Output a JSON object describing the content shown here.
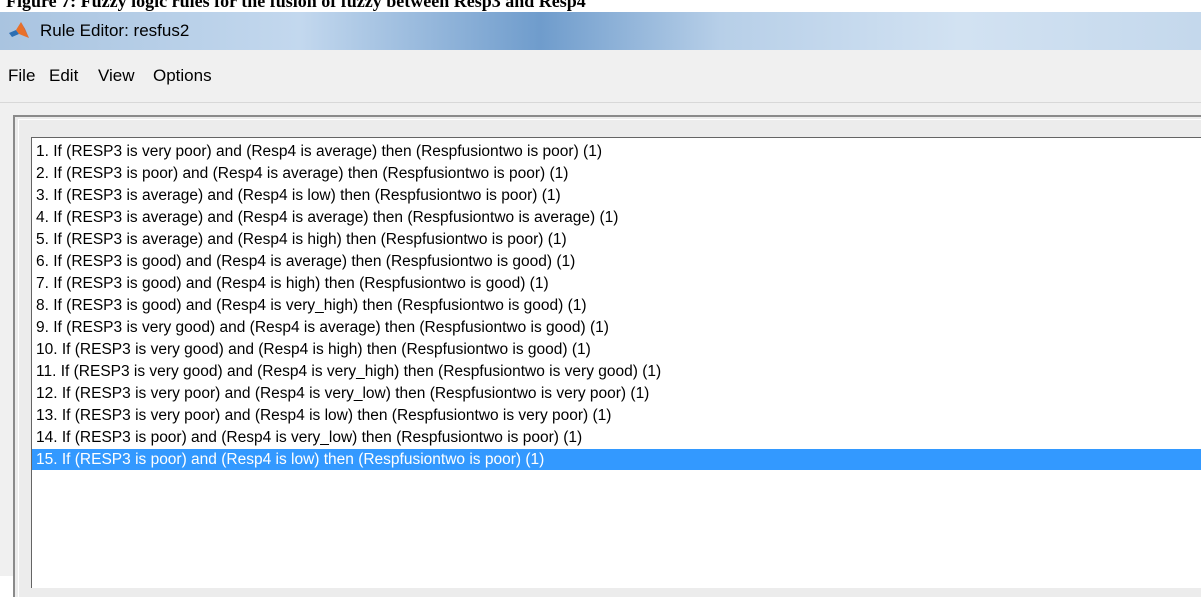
{
  "caption": "Figure 7: Fuzzy logic rules for the fusion of fuzzy between Resp3 and Resp4",
  "window": {
    "title": "Rule Editor: resfus2",
    "icon": "matlab-logo-icon"
  },
  "menu": {
    "items": [
      {
        "label": "File"
      },
      {
        "label": "Edit"
      },
      {
        "label": "View"
      },
      {
        "label": "Options"
      }
    ]
  },
  "rules": {
    "selected_index": 15,
    "items": [
      {
        "text": "1. If (RESP3 is very poor) and (Resp4 is average) then (Respfusiontwo is poor) (1)"
      },
      {
        "text": "2. If (RESP3 is poor) and (Resp4 is average) then (Respfusiontwo is poor) (1)"
      },
      {
        "text": "3. If (RESP3 is average) and (Resp4 is low) then (Respfusiontwo is poor) (1)"
      },
      {
        "text": "4. If (RESP3 is average) and (Resp4 is average) then (Respfusiontwo is average) (1)"
      },
      {
        "text": "5. If (RESP3 is average) and (Resp4 is high) then (Respfusiontwo is poor) (1)"
      },
      {
        "text": "6. If (RESP3 is good) and (Resp4 is average) then (Respfusiontwo is good) (1)"
      },
      {
        "text": "7. If (RESP3 is good) and (Resp4 is high) then (Respfusiontwo is good) (1)"
      },
      {
        "text": "8. If (RESP3 is good) and (Resp4 is very_high) then (Respfusiontwo is good) (1)"
      },
      {
        "text": "9. If (RESP3 is very good) and (Resp4 is average) then (Respfusiontwo is good) (1)"
      },
      {
        "text": "10. If (RESP3 is very good) and (Resp4 is high) then (Respfusiontwo is good) (1)"
      },
      {
        "text": "11. If (RESP3 is very good) and (Resp4 is very_high) then (Respfusiontwo is very good) (1)"
      },
      {
        "text": "12. If (RESP3 is very poor) and (Resp4 is very_low) then (Respfusiontwo is very poor) (1)"
      },
      {
        "text": "13. If (RESP3 is very poor) and (Resp4 is low) then (Respfusiontwo is very poor) (1)"
      },
      {
        "text": "14. If (RESP3 is poor) and (Resp4 is very_low) then (Respfusiontwo is poor) (1)"
      },
      {
        "text": "15. If (RESP3 is poor) and (Resp4 is low) then (Respfusiontwo is poor) (1)"
      }
    ]
  },
  "colors": {
    "selection": "#3399ff",
    "selection_text": "#ffffff",
    "panel": "#f0f0f0"
  }
}
